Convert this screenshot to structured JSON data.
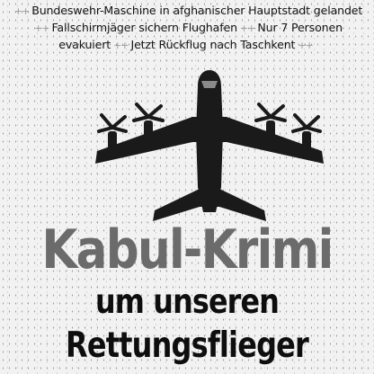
{
  "separator": "++",
  "teaser": {
    "line1": "Bundeswehr-Maschine in afghanischer Hauptstadt gelandet",
    "line2a": "Fallschirmjäger sichern Flughafen",
    "line2b": "Nur 7 Personen",
    "line3a": "evakuiert",
    "line3b": "Jetzt Rückflug nach Taschkent"
  },
  "headline": "Kabul-Krimi",
  "subline1": "um unseren",
  "subline2": "Rettungsflieger",
  "colors": {
    "headline": "#6b6b6b",
    "text": "#0e0e0e",
    "plane": "#1a1a1a",
    "background": "#f2f2f2"
  }
}
